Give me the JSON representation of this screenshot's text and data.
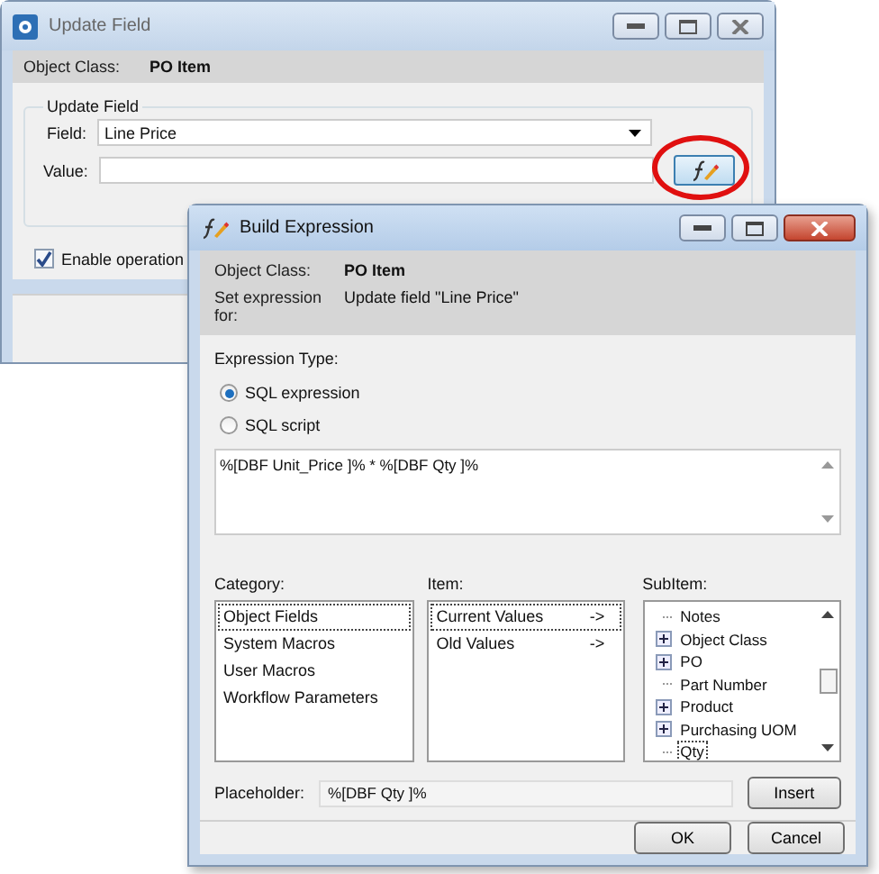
{
  "update_window": {
    "title": "Update Field",
    "object_class_label": "Object Class:",
    "object_class": "PO Item",
    "group_title": "Update Field",
    "field_label": "Field:",
    "field_value": "Line Price",
    "value_label": "Value:",
    "expression_button_highlighted": true,
    "enable_operation": {
      "label": "Enable operation",
      "checked": true
    }
  },
  "build_window": {
    "title": "Build Expression",
    "object_class_label": "Object Class:",
    "object_class": "PO Item",
    "set_for_label": "Set expression for:",
    "set_for": "Update field \"Line Price\"",
    "expression_type_label": "Expression Type:",
    "expression_types": [
      {
        "label": "SQL expression",
        "selected": true
      },
      {
        "label": "SQL script",
        "selected": false
      }
    ],
    "expression": "%[DBF Unit_Price ]% * %[DBF Qty ]%",
    "category_label": "Category:",
    "categories": [
      {
        "label": "Object Fields",
        "selected": true
      },
      {
        "label": "System Macros",
        "selected": false
      },
      {
        "label": "User Macros",
        "selected": false
      },
      {
        "label": "Workflow Parameters",
        "selected": false
      }
    ],
    "item_label": "Item:",
    "items": [
      {
        "label": "Current Values",
        "arrow": "->",
        "selected": true
      },
      {
        "label": "Old Values",
        "arrow": "->",
        "selected": false
      }
    ],
    "subitem_label": "SubItem:",
    "subitems": [
      {
        "label": "Notes",
        "expandable": false,
        "selected": false
      },
      {
        "label": "Object Class",
        "expandable": true,
        "selected": false
      },
      {
        "label": "PO",
        "expandable": true,
        "selected": false
      },
      {
        "label": "Part Number",
        "expandable": false,
        "selected": false
      },
      {
        "label": "Product",
        "expandable": true,
        "selected": false
      },
      {
        "label": "Purchasing UOM",
        "expandable": true,
        "selected": false
      },
      {
        "label": "Qty",
        "expandable": false,
        "selected": true
      }
    ],
    "placeholder_label": "Placeholder:",
    "placeholder_value": "%[DBF Qty ]%",
    "insert_button": "Insert",
    "ok_button": "OK",
    "cancel_button": "Cancel"
  }
}
